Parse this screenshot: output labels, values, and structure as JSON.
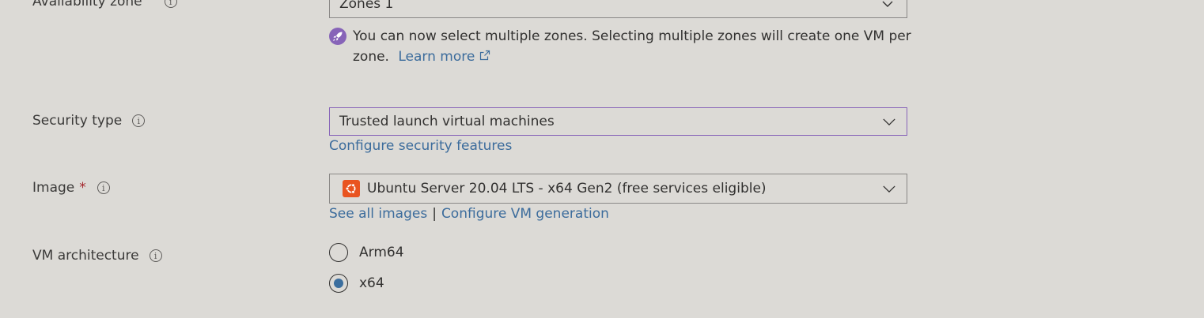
{
  "availability_zone": {
    "label": "Availability zone",
    "selected": "Zones 1",
    "notice_text": "You can now select multiple zones. Selecting multiple zones will create one VM per zone.",
    "notice_link": "Learn more"
  },
  "security_type": {
    "label": "Security type",
    "selected": "Trusted launch virtual machines",
    "link": "Configure security features"
  },
  "image": {
    "label": "Image",
    "required_mark": "*",
    "selected": "Ubuntu Server 20.04 LTS - x64 Gen2 (free services eligible)",
    "link1": "See all images",
    "separator": "|",
    "link2": "Configure VM generation"
  },
  "vm_architecture": {
    "label": "VM architecture",
    "options": [
      {
        "label": "Arm64",
        "checked": false
      },
      {
        "label": "x64",
        "checked": true
      }
    ]
  },
  "colors": {
    "accent_purple": "#8764b8",
    "link_blue": "#3c6c9c",
    "ubuntu_orange": "#e95420",
    "required_red": "#a4262c"
  },
  "icons": {
    "info": "info-icon",
    "chevron": "chevron-down-icon",
    "rocket": "rocket-icon",
    "external_link": "external-link-icon",
    "ubuntu": "ubuntu-logo-icon"
  }
}
